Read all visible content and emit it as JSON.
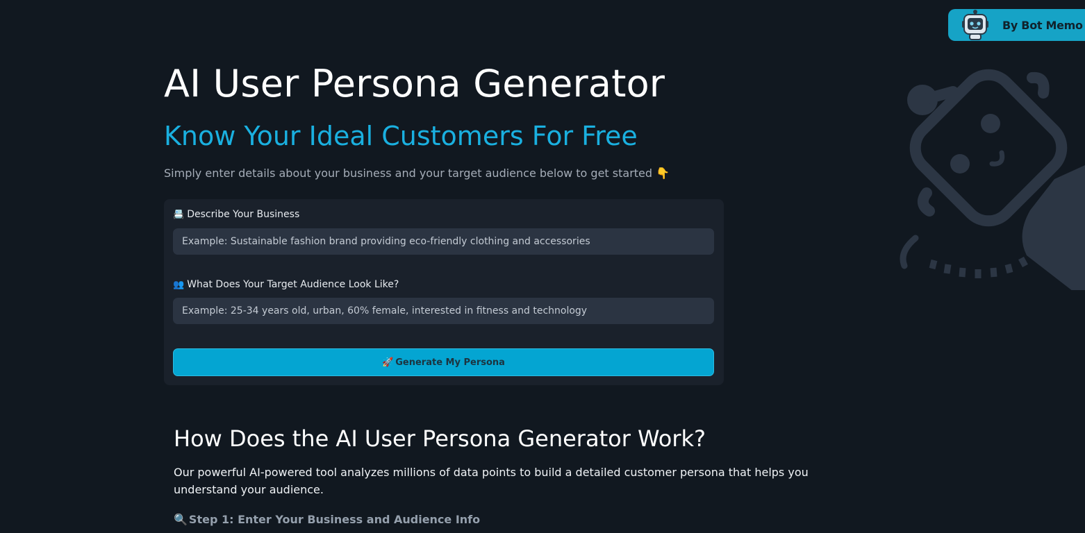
{
  "brand": {
    "label": "By Bot Memo",
    "icon": "robot-icon"
  },
  "hero": {
    "title": "AI User Persona Generator",
    "subtitle": "Know Your Ideal Customers For Free",
    "intro": "Simply enter details about your business and your target audience below to get started 👇"
  },
  "form": {
    "business": {
      "emoji": "📇",
      "label": "Describe Your Business",
      "placeholder": "Example: Sustainable fashion brand providing eco-friendly clothing and accessories",
      "value": ""
    },
    "audience": {
      "emoji": "👥",
      "label": "What Does Your Target Audience Look Like?",
      "placeholder": "Example: 25-34 years old, urban, 60% female, interested in fitness and technology",
      "value": ""
    },
    "submit": {
      "emoji": "🚀",
      "label": "Generate My Persona"
    }
  },
  "how_it_works": {
    "title": "How Does the AI User Persona Generator Work?",
    "body": "Our powerful AI-powered tool analyzes millions of data points to build a detailed customer persona that helps you understand your audience.",
    "step1": {
      "emoji": "🔍",
      "label": "Step 1: Enter Your Business and Audience Info"
    }
  },
  "colors": {
    "background": "#111820",
    "accent": "#1ab0e0",
    "button": "#04a5d2",
    "card": "#1a212b",
    "input": "#2b3442"
  }
}
